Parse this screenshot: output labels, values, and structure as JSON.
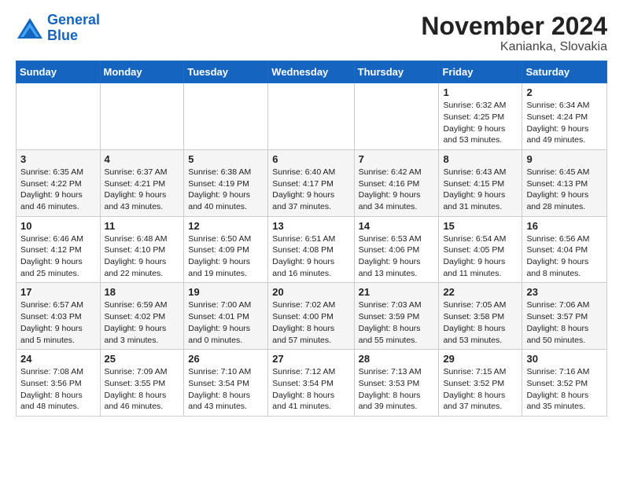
{
  "header": {
    "logo_line1": "General",
    "logo_line2": "Blue",
    "month_title": "November 2024",
    "location": "Kanianka, Slovakia"
  },
  "weekdays": [
    "Sunday",
    "Monday",
    "Tuesday",
    "Wednesday",
    "Thursday",
    "Friday",
    "Saturday"
  ],
  "weeks": [
    [
      {
        "day": "",
        "info": ""
      },
      {
        "day": "",
        "info": ""
      },
      {
        "day": "",
        "info": ""
      },
      {
        "day": "",
        "info": ""
      },
      {
        "day": "",
        "info": ""
      },
      {
        "day": "1",
        "info": "Sunrise: 6:32 AM\nSunset: 4:25 PM\nDaylight: 9 hours and 53 minutes."
      },
      {
        "day": "2",
        "info": "Sunrise: 6:34 AM\nSunset: 4:24 PM\nDaylight: 9 hours and 49 minutes."
      }
    ],
    [
      {
        "day": "3",
        "info": "Sunrise: 6:35 AM\nSunset: 4:22 PM\nDaylight: 9 hours and 46 minutes."
      },
      {
        "day": "4",
        "info": "Sunrise: 6:37 AM\nSunset: 4:21 PM\nDaylight: 9 hours and 43 minutes."
      },
      {
        "day": "5",
        "info": "Sunrise: 6:38 AM\nSunset: 4:19 PM\nDaylight: 9 hours and 40 minutes."
      },
      {
        "day": "6",
        "info": "Sunrise: 6:40 AM\nSunset: 4:17 PM\nDaylight: 9 hours and 37 minutes."
      },
      {
        "day": "7",
        "info": "Sunrise: 6:42 AM\nSunset: 4:16 PM\nDaylight: 9 hours and 34 minutes."
      },
      {
        "day": "8",
        "info": "Sunrise: 6:43 AM\nSunset: 4:15 PM\nDaylight: 9 hours and 31 minutes."
      },
      {
        "day": "9",
        "info": "Sunrise: 6:45 AM\nSunset: 4:13 PM\nDaylight: 9 hours and 28 minutes."
      }
    ],
    [
      {
        "day": "10",
        "info": "Sunrise: 6:46 AM\nSunset: 4:12 PM\nDaylight: 9 hours and 25 minutes."
      },
      {
        "day": "11",
        "info": "Sunrise: 6:48 AM\nSunset: 4:10 PM\nDaylight: 9 hours and 22 minutes."
      },
      {
        "day": "12",
        "info": "Sunrise: 6:50 AM\nSunset: 4:09 PM\nDaylight: 9 hours and 19 minutes."
      },
      {
        "day": "13",
        "info": "Sunrise: 6:51 AM\nSunset: 4:08 PM\nDaylight: 9 hours and 16 minutes."
      },
      {
        "day": "14",
        "info": "Sunrise: 6:53 AM\nSunset: 4:06 PM\nDaylight: 9 hours and 13 minutes."
      },
      {
        "day": "15",
        "info": "Sunrise: 6:54 AM\nSunset: 4:05 PM\nDaylight: 9 hours and 11 minutes."
      },
      {
        "day": "16",
        "info": "Sunrise: 6:56 AM\nSunset: 4:04 PM\nDaylight: 9 hours and 8 minutes."
      }
    ],
    [
      {
        "day": "17",
        "info": "Sunrise: 6:57 AM\nSunset: 4:03 PM\nDaylight: 9 hours and 5 minutes."
      },
      {
        "day": "18",
        "info": "Sunrise: 6:59 AM\nSunset: 4:02 PM\nDaylight: 9 hours and 3 minutes."
      },
      {
        "day": "19",
        "info": "Sunrise: 7:00 AM\nSunset: 4:01 PM\nDaylight: 9 hours and 0 minutes."
      },
      {
        "day": "20",
        "info": "Sunrise: 7:02 AM\nSunset: 4:00 PM\nDaylight: 8 hours and 57 minutes."
      },
      {
        "day": "21",
        "info": "Sunrise: 7:03 AM\nSunset: 3:59 PM\nDaylight: 8 hours and 55 minutes."
      },
      {
        "day": "22",
        "info": "Sunrise: 7:05 AM\nSunset: 3:58 PM\nDaylight: 8 hours and 53 minutes."
      },
      {
        "day": "23",
        "info": "Sunrise: 7:06 AM\nSunset: 3:57 PM\nDaylight: 8 hours and 50 minutes."
      }
    ],
    [
      {
        "day": "24",
        "info": "Sunrise: 7:08 AM\nSunset: 3:56 PM\nDaylight: 8 hours and 48 minutes."
      },
      {
        "day": "25",
        "info": "Sunrise: 7:09 AM\nSunset: 3:55 PM\nDaylight: 8 hours and 46 minutes."
      },
      {
        "day": "26",
        "info": "Sunrise: 7:10 AM\nSunset: 3:54 PM\nDaylight: 8 hours and 43 minutes."
      },
      {
        "day": "27",
        "info": "Sunrise: 7:12 AM\nSunset: 3:54 PM\nDaylight: 8 hours and 41 minutes."
      },
      {
        "day": "28",
        "info": "Sunrise: 7:13 AM\nSunset: 3:53 PM\nDaylight: 8 hours and 39 minutes."
      },
      {
        "day": "29",
        "info": "Sunrise: 7:15 AM\nSunset: 3:52 PM\nDaylight: 8 hours and 37 minutes."
      },
      {
        "day": "30",
        "info": "Sunrise: 7:16 AM\nSunset: 3:52 PM\nDaylight: 8 hours and 35 minutes."
      }
    ]
  ]
}
